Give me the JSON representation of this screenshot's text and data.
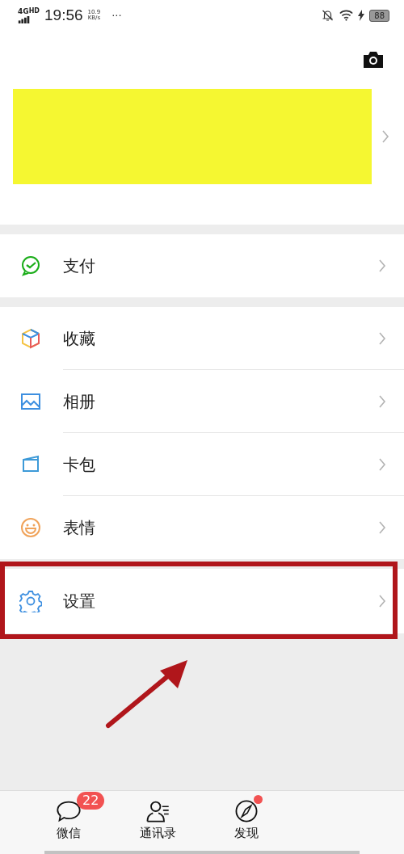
{
  "status_bar": {
    "network": "4G",
    "network_sup": "HD",
    "time": "19:56",
    "speed": "10.9",
    "speed_unit": "KB/s",
    "more": "···",
    "battery": "88"
  },
  "menu_groups": [
    [
      {
        "kind": "pay",
        "label": "支付",
        "highlighted": false
      }
    ],
    [
      {
        "kind": "favorites",
        "label": "收藏",
        "highlighted": false
      },
      {
        "kind": "album",
        "label": "相册",
        "highlighted": false
      },
      {
        "kind": "cards",
        "label": "卡包",
        "highlighted": false
      },
      {
        "kind": "stickers",
        "label": "表情",
        "highlighted": false
      }
    ],
    [
      {
        "kind": "settings",
        "label": "设置",
        "highlighted": true
      }
    ]
  ],
  "tab_bar": [
    {
      "kind": "chats",
      "label": "微信",
      "badge": "22",
      "dot": false,
      "selected": false
    },
    {
      "kind": "contacts",
      "label": "通讯录",
      "dot": false,
      "selected": false
    },
    {
      "kind": "discover",
      "label": "发现",
      "dot": true,
      "selected": false
    }
  ]
}
